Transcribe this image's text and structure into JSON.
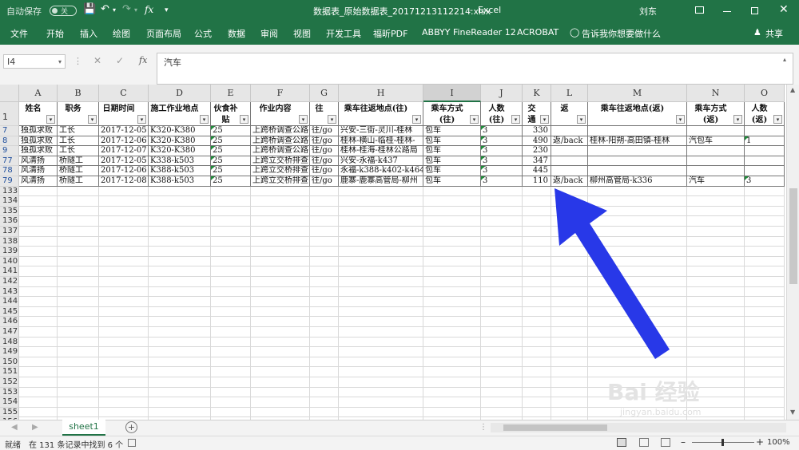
{
  "titlebar": {
    "autosave_label": "自动保存",
    "autosave_state": "关",
    "filename": "数据表_原始数据表_20171213112214.xlsx",
    "app": "Excel",
    "user": "刘东"
  },
  "ribbon_tabs": [
    "文件",
    "开始",
    "插入",
    "绘图",
    "页面布局",
    "公式",
    "数据",
    "审阅",
    "视图",
    "开发工具",
    "福昕PDF",
    "ABBYY FineReader 12",
    "ACROBAT"
  ],
  "tell_me": "告诉我你想要做什么",
  "share_label": "共享",
  "formula_bar": {
    "name_box": "I4",
    "formula": "汽车"
  },
  "columns": [
    "A",
    "B",
    "C",
    "D",
    "E",
    "F",
    "G",
    "H",
    "I",
    "J",
    "K",
    "L",
    "M",
    "N",
    "O"
  ],
  "selected_column": "I",
  "header_row": {
    "row_num": "1",
    "cells": [
      "姓名",
      "职务",
      "日期时间",
      "施工作业地点",
      "伙食补贴",
      "作业内容",
      "往",
      "乘车往返地点(往)",
      "乘车方式(往)",
      "人数(往)",
      "交通费金额",
      "返",
      "乘车往返地点(返)",
      "乘车方式(返)",
      "人数(返)"
    ]
  },
  "data_rows": [
    {
      "row_num": "7",
      "cells": [
        "独孤求败",
        "工长",
        "2017-12-05",
        "K320-K380",
        "25",
        "上跨桥调查公路",
        "往/go",
        "兴安-三街-灵川-桂林",
        "包车",
        "3",
        "330",
        "",
        "",
        "",
        ""
      ]
    },
    {
      "row_num": "8",
      "cells": [
        "独孤求败",
        "工长",
        "2017-12-06",
        "K320-K380",
        "25",
        "上跨桥调查公路",
        "往/go",
        "桂林-横山-临桂-桂林-",
        "包车",
        "3",
        "490",
        "返/back",
        "桂林-阳朔-高田镇-桂林",
        "汽包车",
        "1"
      ]
    },
    {
      "row_num": "9",
      "cells": [
        "独孤求败",
        "工长",
        "2017-12-07",
        "K320-K380",
        "25",
        "上跨桥调查公路",
        "往/go",
        "桂林-桂海-桂林公路局",
        "包车",
        "3",
        "230",
        "",
        "",
        "",
        ""
      ]
    },
    {
      "row_num": "77",
      "cells": [
        "风清扬",
        "桥隧工",
        "2017-12-05",
        "K338-k503",
        "25",
        "上跨立交桥排查",
        "往/go",
        "兴安-永福-k437",
        "包车",
        "3",
        "347",
        "",
        "",
        "",
        ""
      ]
    },
    {
      "row_num": "78",
      "cells": [
        "风清扬",
        "桥隧工",
        "2017-12-06",
        "K388-k503",
        "25",
        "上跨立交桥排查",
        "往/go",
        "永福-k388-k402-k464",
        "包车",
        "3",
        "445",
        "",
        "",
        "",
        ""
      ]
    },
    {
      "row_num": "79",
      "cells": [
        "风清扬",
        "桥隧工",
        "2017-12-08",
        "K388-k503",
        "25",
        "上跨立交桥排查",
        "往/go",
        "鹿寨-鹿寨高管局-柳州",
        "包车",
        "3",
        "110",
        "返/back",
        "柳州高管局-k336",
        "汽车",
        "3"
      ]
    }
  ],
  "empty_rows": [
    "133",
    "134",
    "135",
    "136",
    "137",
    "138",
    "139",
    "140",
    "141",
    "142",
    "143",
    "144",
    "145",
    "146",
    "147",
    "148",
    "149",
    "150",
    "151",
    "152",
    "153",
    "154",
    "155",
    "156"
  ],
  "sheet_tabs": [
    "sheet1"
  ],
  "status": {
    "ready": "就绪",
    "found": "在 131 条记录中找到 6 个",
    "zoom": "100%"
  },
  "watermark": {
    "text": "Bai 经验",
    "url": "jingyan.baidu.com"
  },
  "arrow_color": "#2838e8",
  "accent_color": "#217346"
}
